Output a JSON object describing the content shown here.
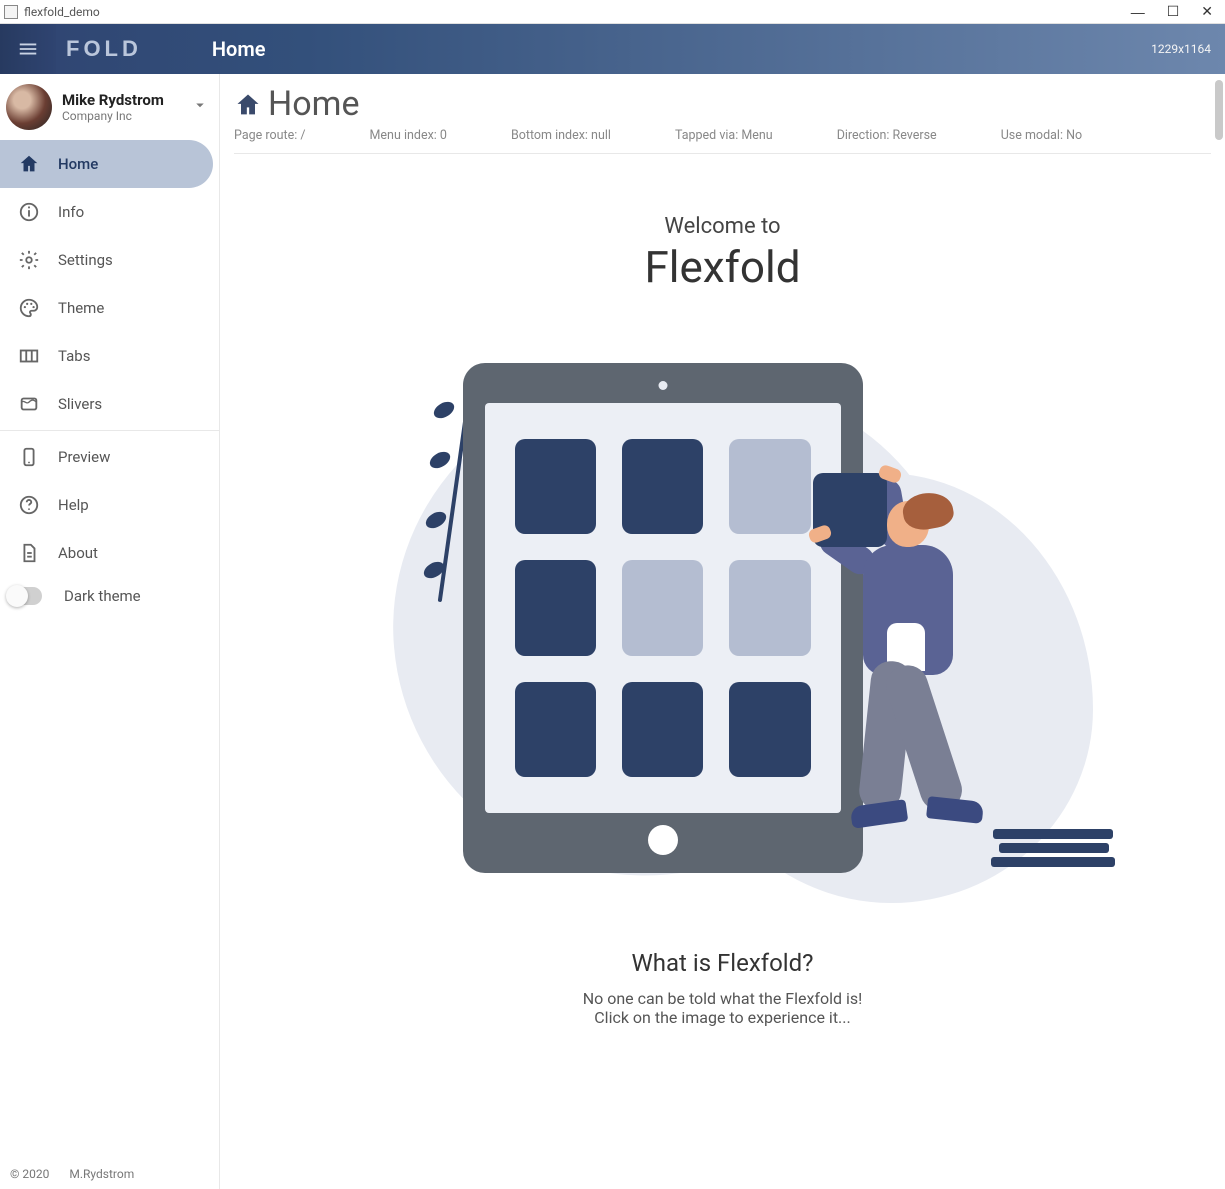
{
  "window": {
    "title": "flexfold_demo"
  },
  "appbar": {
    "logo": "FOLD",
    "title": "Home",
    "dimensions": "1229x1164"
  },
  "user": {
    "name": "Mike Rydstrom",
    "subtitle": "Company Inc"
  },
  "sidebar": {
    "items": [
      {
        "label": "Home",
        "icon": "home"
      },
      {
        "label": "Info",
        "icon": "info"
      },
      {
        "label": "Settings",
        "icon": "settings"
      },
      {
        "label": "Theme",
        "icon": "palette"
      },
      {
        "label": "Tabs",
        "icon": "tabs"
      },
      {
        "label": "Slivers",
        "icon": "slivers"
      },
      {
        "label": "Preview",
        "icon": "phone"
      },
      {
        "label": "Help",
        "icon": "help"
      },
      {
        "label": "About",
        "icon": "doc"
      }
    ],
    "dark_theme_label": "Dark theme",
    "footer_left": "© 2020",
    "footer_right": "M.Rydstrom"
  },
  "page": {
    "title": "Home",
    "meta": {
      "route": "Page route: /",
      "menu_index": "Menu index: 0",
      "bottom_index": "Bottom index: null",
      "tapped_via": "Tapped via: Menu",
      "direction": "Direction: Reverse",
      "use_modal": "Use modal: No"
    },
    "welcome_small": "Welcome to",
    "welcome_big": "Flexfold",
    "what_title": "What is Flexfold?",
    "what_line1": "No one can be told what the Flexfold is!",
    "what_line2": "Click on the image to experience it..."
  }
}
